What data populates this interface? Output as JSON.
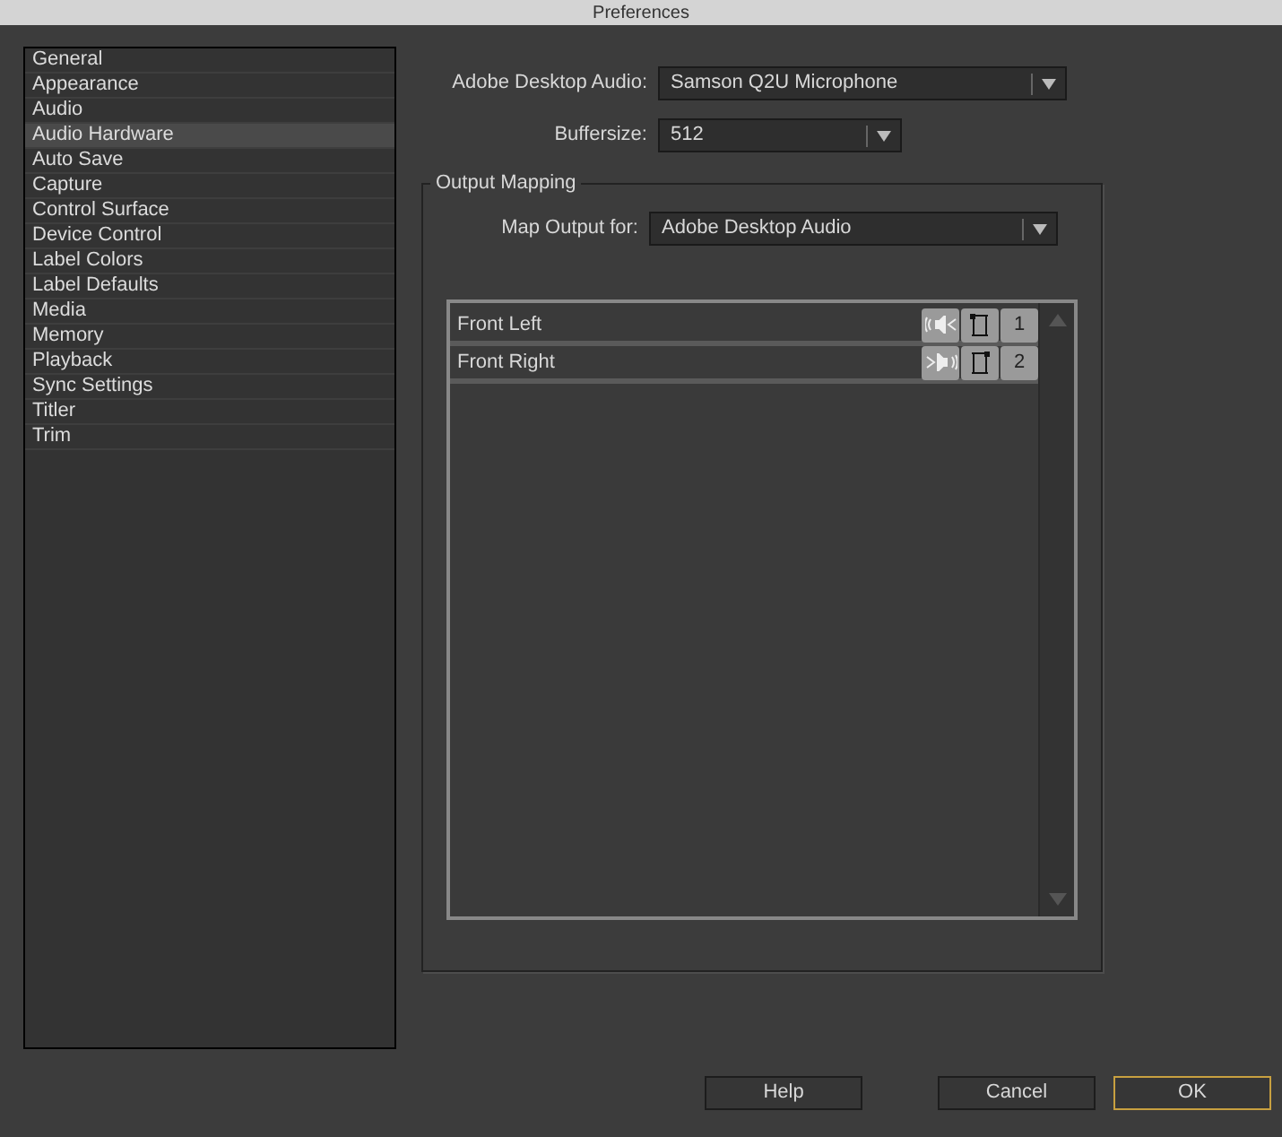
{
  "window": {
    "title": "Preferences"
  },
  "sidebar": {
    "items": [
      {
        "label": "General",
        "selected": false
      },
      {
        "label": "Appearance",
        "selected": false
      },
      {
        "label": "Audio",
        "selected": false
      },
      {
        "label": "Audio Hardware",
        "selected": true
      },
      {
        "label": "Auto Save",
        "selected": false
      },
      {
        "label": "Capture",
        "selected": false
      },
      {
        "label": "Control Surface",
        "selected": false
      },
      {
        "label": "Device Control",
        "selected": false
      },
      {
        "label": "Label Colors",
        "selected": false
      },
      {
        "label": "Label Defaults",
        "selected": false
      },
      {
        "label": "Media",
        "selected": false
      },
      {
        "label": "Memory",
        "selected": false
      },
      {
        "label": "Playback",
        "selected": false
      },
      {
        "label": "Sync Settings",
        "selected": false
      },
      {
        "label": "Titler",
        "selected": false
      },
      {
        "label": "Trim",
        "selected": false
      }
    ]
  },
  "device": {
    "label": "Adobe Desktop Audio:",
    "value": "Samson Q2U Microphone"
  },
  "buffersize": {
    "label": "Buffersize:",
    "value": "512"
  },
  "output_mapping": {
    "title": "Output Mapping",
    "map_output_for": {
      "label": "Map Output for:",
      "value": "Adobe Desktop Audio"
    },
    "channels": [
      {
        "name": "Front Left",
        "kind": "left",
        "number": "1"
      },
      {
        "name": "Front Right",
        "kind": "right",
        "number": "2"
      }
    ]
  },
  "buttons": [
    {
      "label": "Help",
      "default": false
    },
    {
      "label": "Cancel",
      "default": false
    },
    {
      "label": "OK",
      "default": true
    }
  ]
}
